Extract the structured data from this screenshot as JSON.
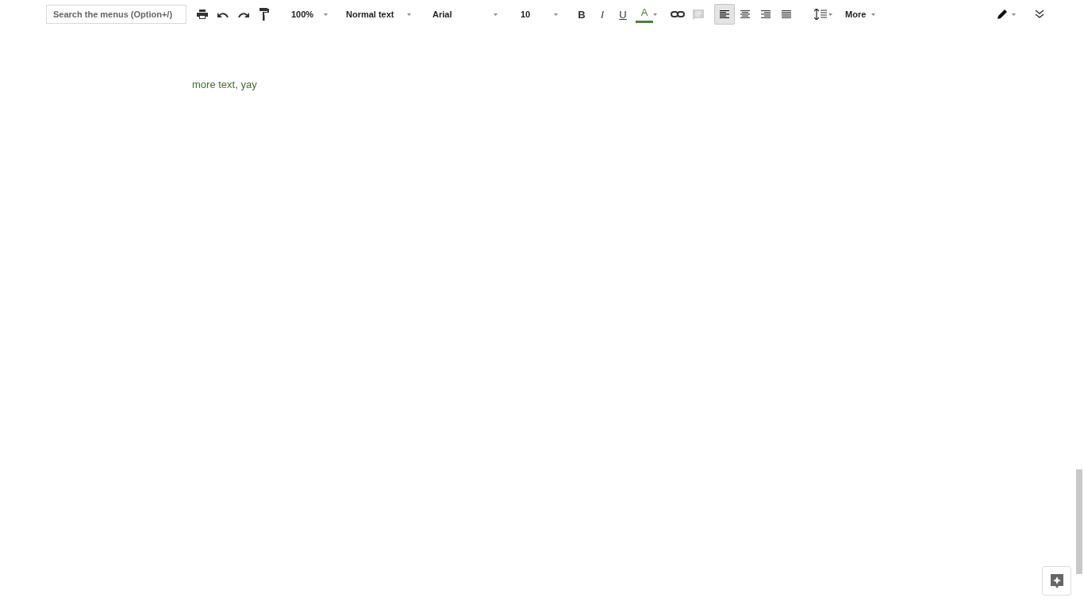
{
  "toolbar": {
    "search": {
      "placeholder": "Search the menus (Option+/)"
    },
    "zoom": {
      "value": "100%"
    },
    "style": {
      "value": "Normal text"
    },
    "font": {
      "value": "Arial"
    },
    "size": {
      "value": "10"
    },
    "format_buttons": [
      {
        "kind": "bold",
        "label": "B"
      },
      {
        "kind": "italic",
        "label": "I"
      },
      {
        "kind": "underline",
        "label": "U"
      }
    ],
    "text_color": {
      "label": "A",
      "color": "#4f7f3a"
    },
    "comment": {
      "disabled": true
    },
    "align_buttons": [
      {
        "kind": "left",
        "selected": true
      },
      {
        "kind": "center",
        "selected": false
      },
      {
        "kind": "right",
        "selected": false
      },
      {
        "kind": "justify",
        "selected": false
      }
    ],
    "more": {
      "label": "More"
    }
  },
  "document": {
    "paragraphs": [
      "more text, yay"
    ]
  }
}
